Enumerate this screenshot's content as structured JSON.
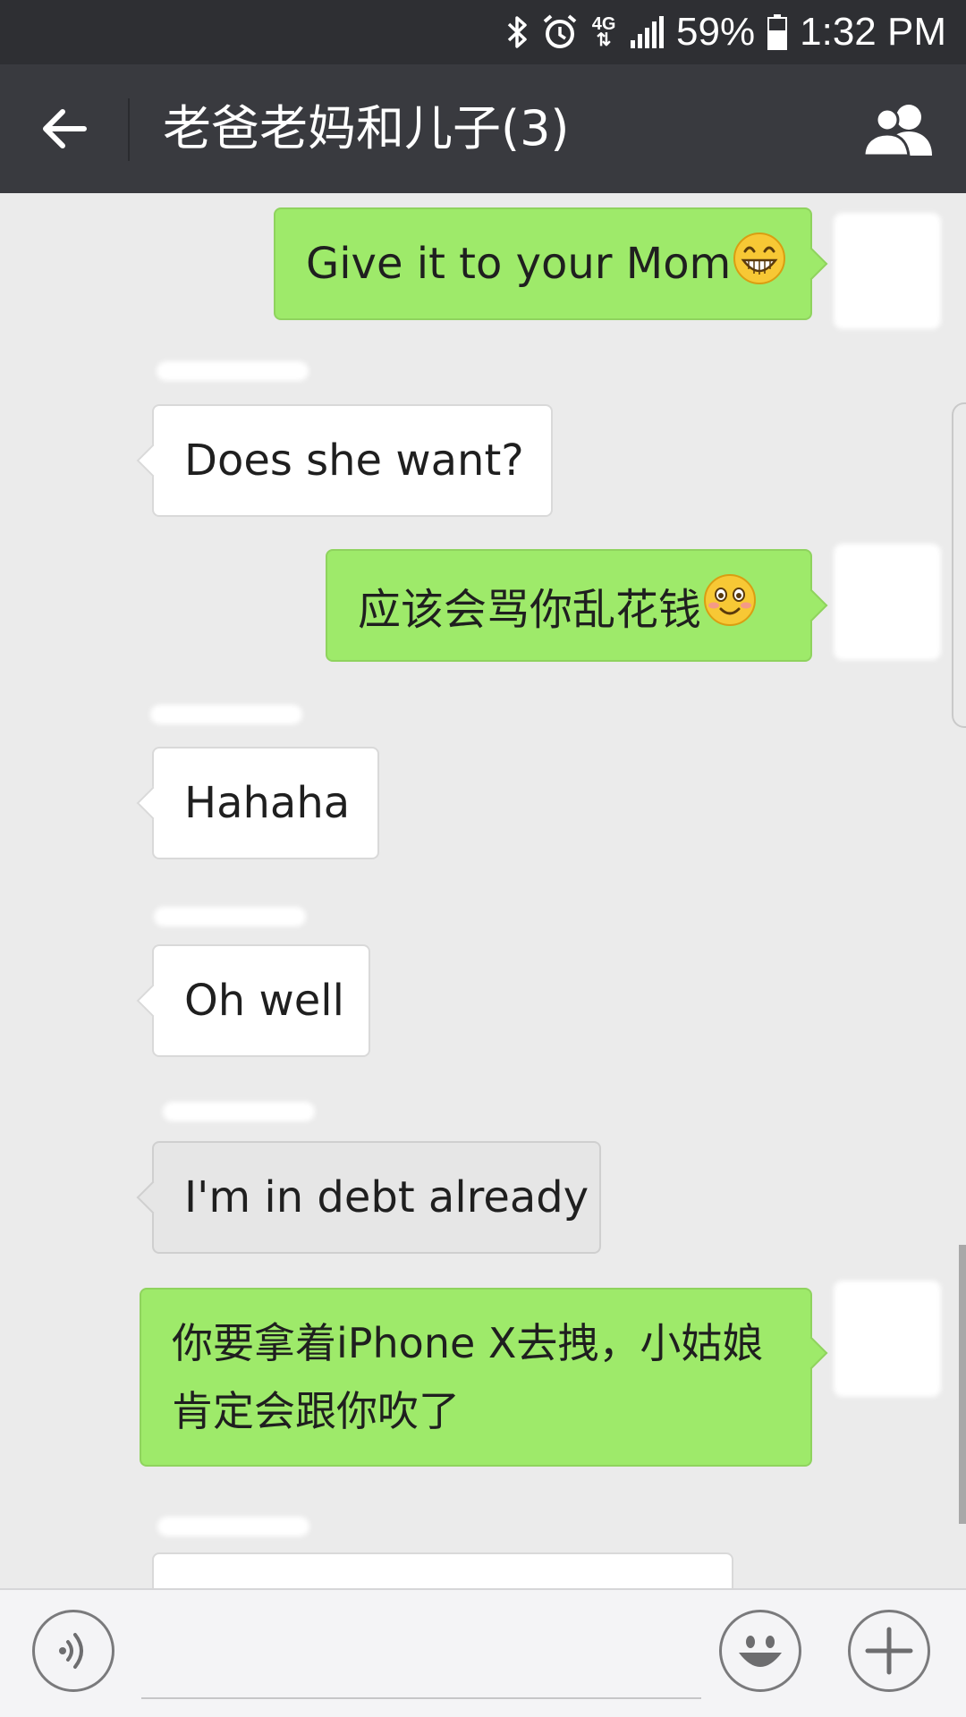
{
  "status_bar": {
    "network": "4G",
    "battery": "59%",
    "time": "1:32 PM",
    "icons": [
      "bluetooth-icon",
      "alarm-icon",
      "network-4g-icon",
      "signal-icon",
      "battery-icon"
    ]
  },
  "header": {
    "title": "老爸老妈和儿子(3)",
    "back_icon": "arrow-left-icon",
    "members_icon": "group-members-icon"
  },
  "messages": [
    {
      "direction": "sent",
      "text": "Give it to your Mom",
      "emoji": "grin-emoji"
    },
    {
      "direction": "received",
      "text": "Does she want?"
    },
    {
      "direction": "sent",
      "text": "应该会骂你乱花钱",
      "emoji": "blush-emoji"
    },
    {
      "direction": "received",
      "text": "Hahaha"
    },
    {
      "direction": "received",
      "text": "Oh well"
    },
    {
      "direction": "received",
      "text": "I'm in debt already",
      "state": "pressed"
    },
    {
      "direction": "sent",
      "text": "你要拿着iPhone X去拽，小姑娘肯定会跟你吹了"
    },
    {
      "direction": "received",
      "text": ""
    }
  ],
  "input_bar": {
    "voice_icon": "voice-input-icon",
    "emoji_icon": "smiley-icon",
    "more_icon": "plus-icon",
    "text_value": ""
  },
  "colors": {
    "status_bar_bg": "#2e2f33",
    "title_bar_bg": "#393a3f",
    "chat_bg": "#ebebeb",
    "sent_bubble": "#9eea6a",
    "received_bubble": "#ffffff"
  }
}
